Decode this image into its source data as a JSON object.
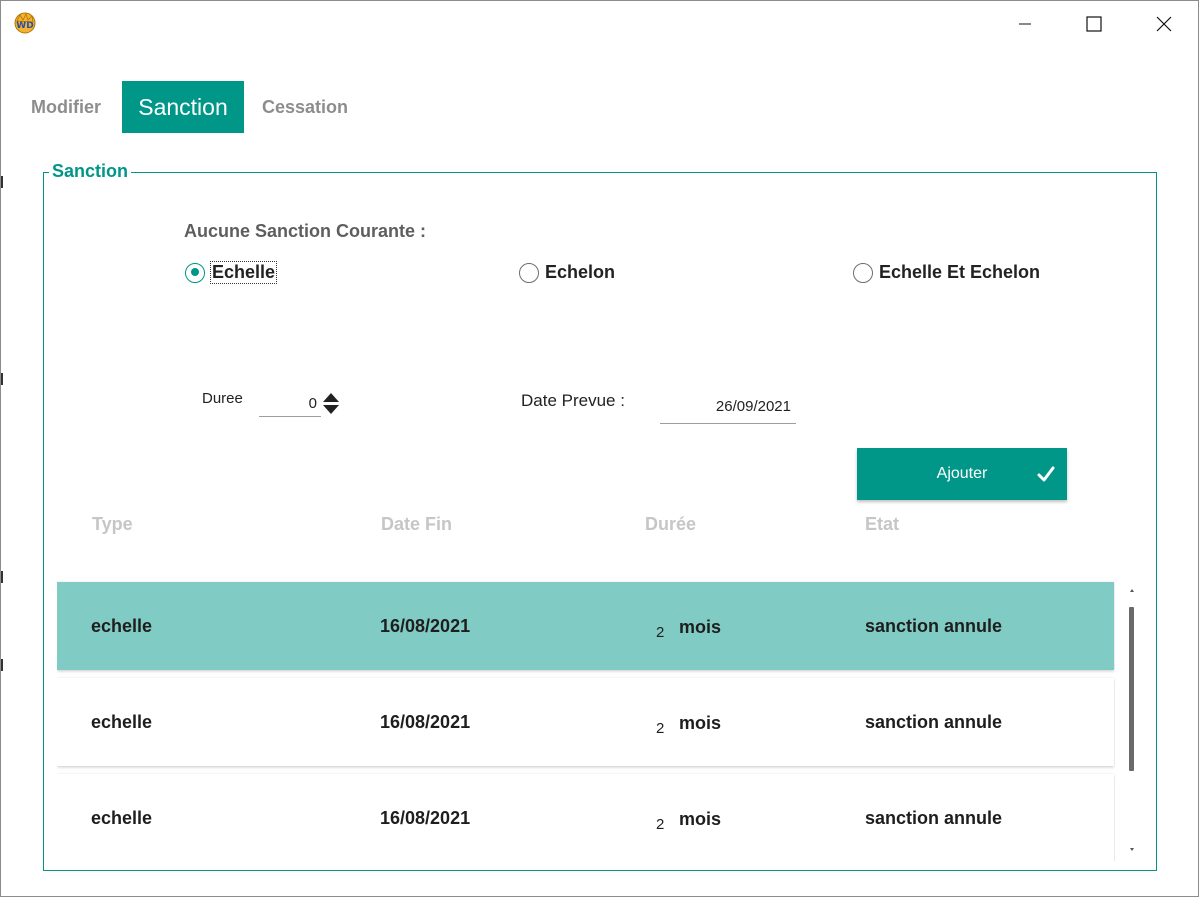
{
  "window": {
    "icon": "windev-app-icon",
    "controls": {
      "minimize": "minimize-icon",
      "maximize": "maximize-icon",
      "close": "close-icon"
    }
  },
  "tabs": [
    {
      "label": "Modifier",
      "active": false
    },
    {
      "label": "Sanction",
      "active": true
    },
    {
      "label": "Cessation",
      "active": false
    }
  ],
  "group": {
    "title": "Sanction",
    "current_label": "Aucune Sanction Courante :",
    "radios": [
      {
        "label": "Echelle",
        "checked": true
      },
      {
        "label": "Echelon",
        "checked": false
      },
      {
        "label": "Echelle Et Echelon",
        "checked": false
      }
    ],
    "duree": {
      "label": "Duree",
      "value": "0"
    },
    "date_prevue": {
      "label": "Date Prevue :",
      "value": "26/09/2021"
    },
    "add_button": {
      "label": "Ajouter",
      "icon": "check-icon"
    }
  },
  "table": {
    "headers": [
      "Type",
      "Date Fin",
      "Durée",
      "Etat"
    ],
    "rows": [
      {
        "type": "echelle",
        "date_fin": "16/08/2021",
        "duree_num": "2",
        "duree_unit": "mois",
        "etat": "sanction annule",
        "selected": true
      },
      {
        "type": "echelle",
        "date_fin": "16/08/2021",
        "duree_num": "2",
        "duree_unit": "mois",
        "etat": "sanction annule",
        "selected": false
      },
      {
        "type": "echelle",
        "date_fin": "16/08/2021",
        "duree_num": "2",
        "duree_unit": "mois",
        "etat": "sanction annule",
        "selected": false
      }
    ]
  },
  "colors": {
    "accent": "#009688",
    "selected_row": "#80cbc4",
    "header_text": "#c6c6c6",
    "tab_inactive": "#8d8d8d"
  }
}
